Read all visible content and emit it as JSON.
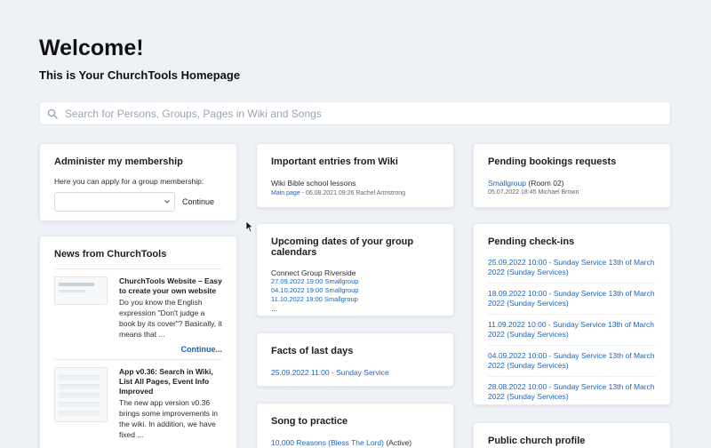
{
  "header": {
    "welcome": "Welcome!",
    "subtitle": "This is Your ChurchTools Homepage"
  },
  "search": {
    "placeholder": "Search for Persons, Groups, Pages in Wiki and Songs"
  },
  "membership": {
    "title": "Administer my membership",
    "description": "Here you can apply for a group membership:",
    "continue_label": "Continue"
  },
  "news": {
    "title": "News from ChurchTools",
    "items": [
      {
        "title": "ChurchTools Website – Easy to create your own website",
        "text": "Do you know the English expression \"Don't judge a book by its cover\"? Basically, it means that ..."
      },
      {
        "title": "App v0.36: Search in Wiki, List All Pages, Event Info Improved",
        "text": "The new app version v0.36 brings some improvements in the wiki. In addition, we have fixed ..."
      }
    ],
    "continue_label": "Continue..."
  },
  "wiki": {
    "title": "Important entries from Wiki",
    "entry_title": "Wiki Bible school lessons",
    "entry_link": "Main page",
    "entry_meta": " - 06.08.2021 09:26 Rachel Armstrong"
  },
  "calendars": {
    "title": "Upcoming dates of your group calendars",
    "group": "Connect Group Riverside",
    "dates": [
      "27.09.2022 19:00 Smallgroup",
      "04.10.2022 19:00 Smallgroup",
      "11.10.2022 19:00 Smallgroup"
    ],
    "more": "..."
  },
  "facts": {
    "title": "Facts of last days",
    "entry": "25.09.2022 11:00 - Sunday Service"
  },
  "song": {
    "title": "Song to practice",
    "entry": "10,000 Reasons (Bless The Lord)",
    "status": " (Active)"
  },
  "bookings": {
    "title": "Pending bookings requests",
    "entry_link": "Smallgroup",
    "entry_room": " (Room 02)",
    "entry_meta": "05.07.2022 18:45 Michael Brown"
  },
  "checkins": {
    "title": "Pending check-ins",
    "items": [
      "25.09.2022 10:00 - Sunday Service 13th of March 2022 (Sunday Services)",
      "18.09.2022 10:00 - Sunday Service 13th of March 2022 (Sunday Services)",
      "11.09.2022 10:00 - Sunday Service 13th of March 2022 (Sunday Services)",
      "04.09.2022 10:00 - Sunday Service 13th of March 2022 (Sunday Services)",
      "28.08.2022 10:00 - Sunday Service 13th of March 2022 (Sunday Services)"
    ]
  },
  "profile": {
    "title": "Public church profile"
  },
  "icons": {
    "search": "search-icon",
    "dropdown": "chevron-down-icon",
    "cursor": "mouse-pointer-icon"
  },
  "colors": {
    "link": "#1d63b8",
    "background": "#eef2f6"
  }
}
